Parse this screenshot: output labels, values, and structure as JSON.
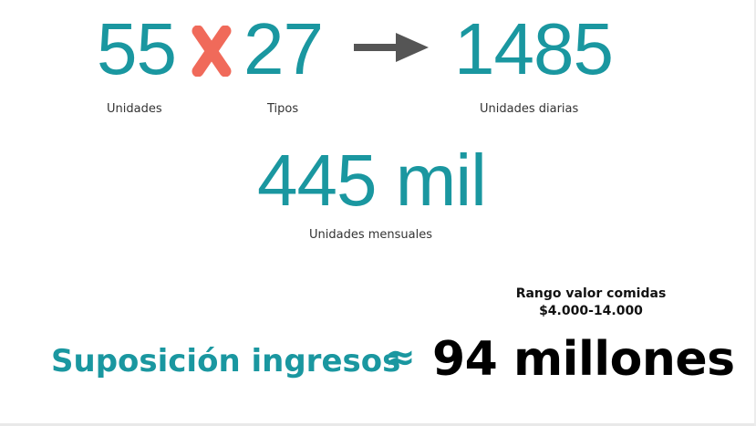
{
  "formula": {
    "units": {
      "value": "55",
      "label": "Unidades"
    },
    "operator_icon": "multiply-cross-icon",
    "types": {
      "value": "27",
      "label": "Tipos"
    },
    "arrow_icon": "right-arrow-icon",
    "daily": {
      "value": "1485",
      "label": "Unidades diarias"
    }
  },
  "monthly": {
    "value": "445 mil",
    "label": "Unidades mensuales"
  },
  "range": {
    "line1": "Rango valor comidas",
    "line2": "$4.000-14.000"
  },
  "income": {
    "label": "Suposición ingresos",
    "approx_symbol": "≈",
    "value": "94 millones"
  },
  "colors": {
    "accent": "#1a97a0",
    "cross": "#f06a5a",
    "arrow": "#555555"
  }
}
